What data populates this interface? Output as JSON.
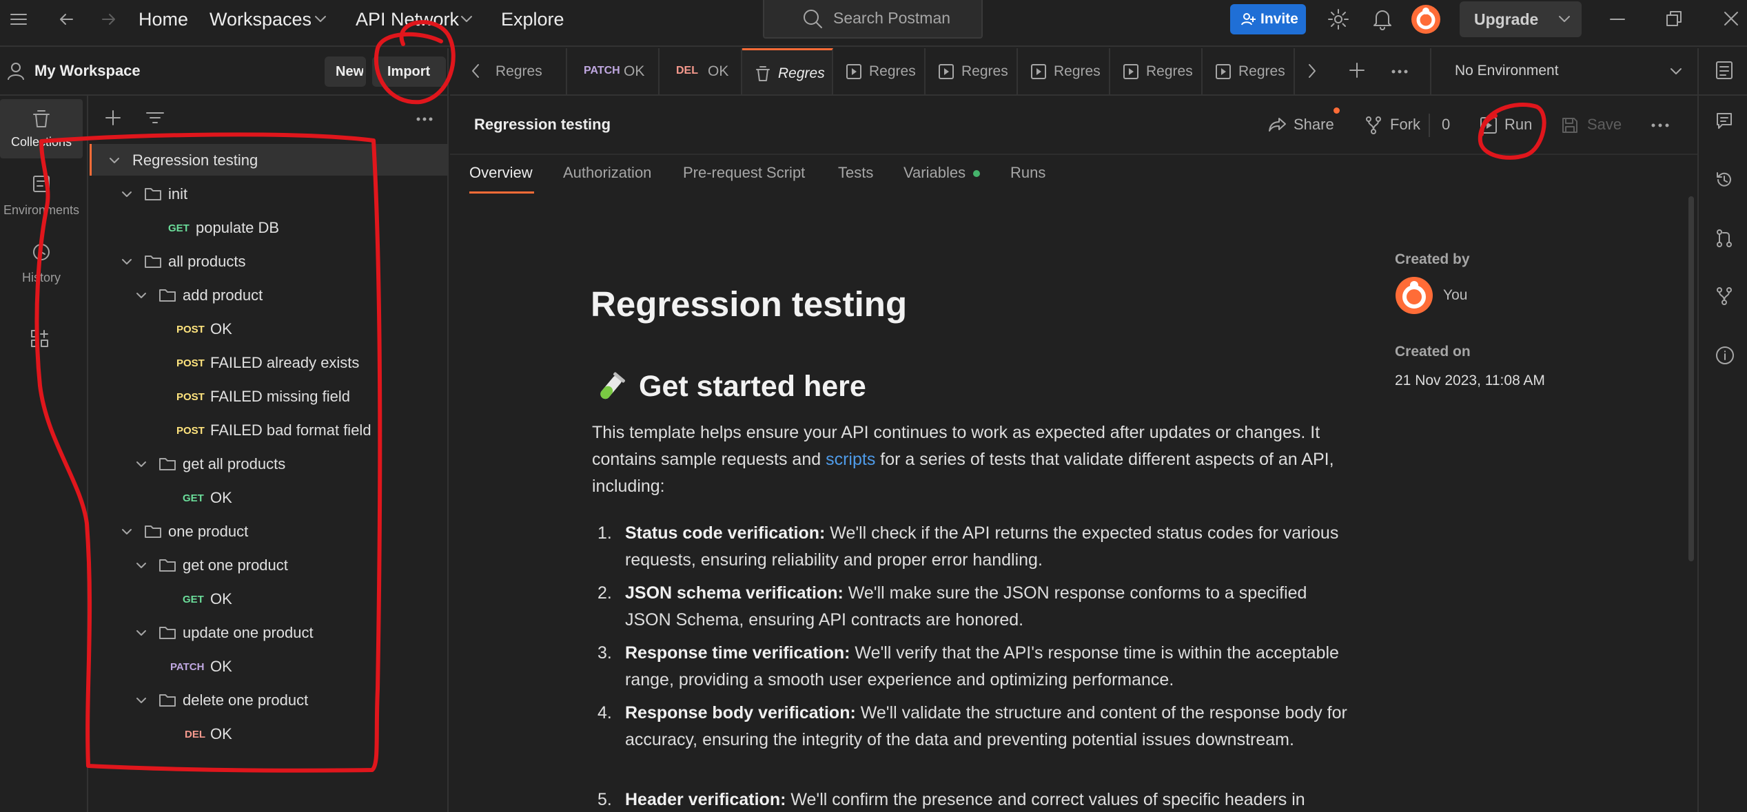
{
  "topbar": {
    "home": "Home",
    "workspaces": "Workspaces",
    "api_network": "API Network",
    "explore": "Explore",
    "search_placeholder": "Search Postman",
    "invite": "Invite",
    "upgrade": "Upgrade"
  },
  "workspace": {
    "name": "My Workspace",
    "new_label": "New",
    "import_label": "Import"
  },
  "rail": [
    {
      "label": "Collections",
      "icon": "collections-icon"
    },
    {
      "label": "Environments",
      "icon": "environments-icon"
    },
    {
      "label": "History",
      "icon": "history-icon"
    },
    {
      "label": "",
      "icon": "add-apps-icon"
    }
  ],
  "tree": [
    {
      "type": "collection",
      "label": "Regression testing",
      "depth": 0
    },
    {
      "type": "folder",
      "label": "init",
      "depth": 1
    },
    {
      "type": "request",
      "method": "GET",
      "label": "populate DB",
      "depth": 2
    },
    {
      "type": "folder",
      "label": "all products",
      "depth": 1
    },
    {
      "type": "folder",
      "label": "add product",
      "depth": 2
    },
    {
      "type": "request",
      "method": "POST",
      "label": "OK",
      "depth": 3
    },
    {
      "type": "request",
      "method": "POST",
      "label": "FAILED already exists",
      "depth": 3
    },
    {
      "type": "request",
      "method": "POST",
      "label": "FAILED missing field",
      "depth": 3
    },
    {
      "type": "request",
      "method": "POST",
      "label": "FAILED bad format field",
      "depth": 3
    },
    {
      "type": "folder",
      "label": "get all products",
      "depth": 2
    },
    {
      "type": "request",
      "method": "GET",
      "label": "OK",
      "depth": 3
    },
    {
      "type": "folder",
      "label": "one product",
      "depth": 1
    },
    {
      "type": "folder",
      "label": "get one product",
      "depth": 2
    },
    {
      "type": "request",
      "method": "GET",
      "label": "OK",
      "depth": 3
    },
    {
      "type": "folder",
      "label": "update one product",
      "depth": 2
    },
    {
      "type": "request",
      "method": "PATCH",
      "label": "OK",
      "depth": 3
    },
    {
      "type": "folder",
      "label": "delete one product",
      "depth": 2
    },
    {
      "type": "request",
      "method": "DEL",
      "label": "OK",
      "depth": 3
    }
  ],
  "tabs": [
    {
      "label": "Regres",
      "method": ""
    },
    {
      "label": "OK",
      "method": "PATCH"
    },
    {
      "label": "OK",
      "method": "DEL"
    },
    {
      "label": "Regres",
      "method": "",
      "active": true
    },
    {
      "label": "Regres",
      "method": ""
    },
    {
      "label": "Regres",
      "method": ""
    },
    {
      "label": "Regres",
      "method": ""
    },
    {
      "label": "Regres",
      "method": ""
    },
    {
      "label": "Regres",
      "method": ""
    }
  ],
  "environment": "No Environment",
  "content": {
    "title": "Regression testing",
    "share": "Share",
    "fork": "Fork",
    "fork_count": "0",
    "run": "Run",
    "save": "Save",
    "subtabs": [
      "Overview",
      "Authorization",
      "Pre-request Script",
      "Tests",
      "Variables",
      "Runs"
    ]
  },
  "doc": {
    "h1": "Regression testing",
    "h2": "Get started here",
    "intro_before": "This template helps ensure your API continues to work as expected after updates or changes. It contains sample requests and ",
    "intro_link": "scripts",
    "intro_after": " for a series of tests that validate different aspects of an API, including:",
    "items": [
      {
        "n": "1.",
        "title": "Status code verification:",
        "text": " We'll check if the API returns the expected status codes for various requests, ensuring reliability and proper error handling."
      },
      {
        "n": "2.",
        "title": "JSON schema verification:",
        "text": " We'll make sure the JSON response conforms to a specified JSON Schema, ensuring API contracts are honored."
      },
      {
        "n": "3.",
        "title": "Response time verification:",
        "text": " We'll verify that the API's response time is within the acceptable range, providing a smooth user experience and optimizing performance."
      },
      {
        "n": "4.",
        "title": "Response body verification:",
        "text": " We'll validate the structure and content of the response body for accuracy, ensuring the integrity of the data and preventing potential issues downstream."
      },
      {
        "n": "5.",
        "title": "Header verification:",
        "text": " We'll confirm the presence and correct values of specific headers in"
      }
    ]
  },
  "meta": {
    "created_by_label": "Created by",
    "created_by": "You",
    "created_on_label": "Created on",
    "created_on": "21 Nov 2023, 11:08 AM"
  },
  "colors": {
    "accent": "#ff6c37",
    "invite": "#1f6fd6",
    "annotation": "#e0161c"
  }
}
